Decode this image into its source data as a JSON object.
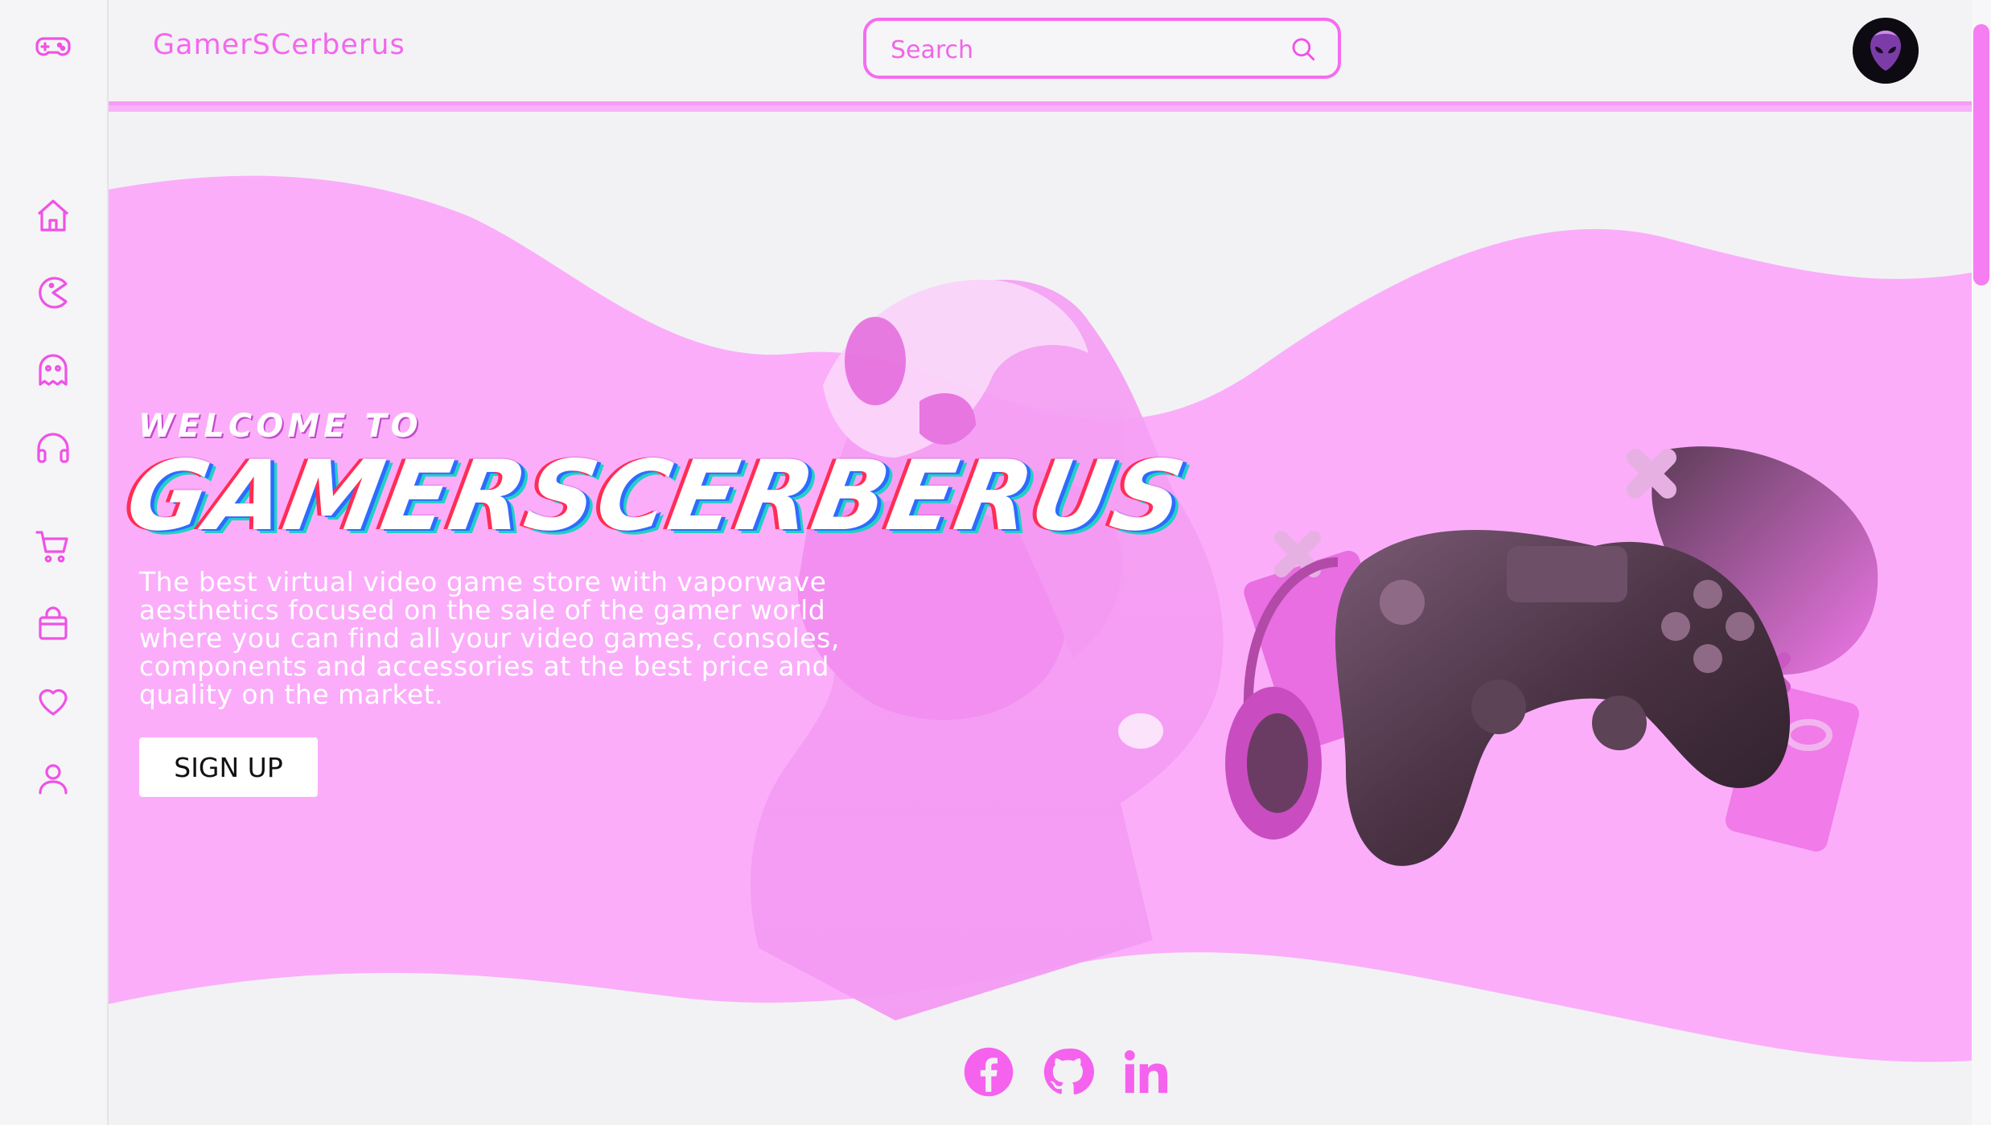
{
  "app": {
    "brand": "GamerSCerberus"
  },
  "search": {
    "placeholder": "Search"
  },
  "sidebar": {
    "logo_icon": "gamepad-icon",
    "items": [
      {
        "icon": "home-icon"
      },
      {
        "icon": "pacman-icon"
      },
      {
        "icon": "ghost-icon"
      },
      {
        "icon": "headphones-icon"
      },
      {
        "icon": "cart-icon"
      },
      {
        "icon": "shopping-bag-icon"
      },
      {
        "icon": "heart-icon"
      },
      {
        "icon": "user-icon"
      }
    ]
  },
  "avatar": {
    "icon": "alien-icon"
  },
  "hero": {
    "welcome": "WELCOME TO",
    "title": "GAMERSCERBERUS",
    "tagline": "The best virtual video game store with vaporwave aesthetics focused on the sale of the gamer world where you can find all your video games, consoles, components and accessories at the best price and quality on the market.",
    "cta_label": "SIGN UP"
  },
  "social": [
    {
      "icon": "facebook-icon"
    },
    {
      "icon": "github-icon"
    },
    {
      "icon": "linkedin-icon"
    }
  ],
  "colors": {
    "accent": "#f46cf0",
    "hero_pink": "#fbadfa",
    "light_bg": "#f2f2f4"
  }
}
